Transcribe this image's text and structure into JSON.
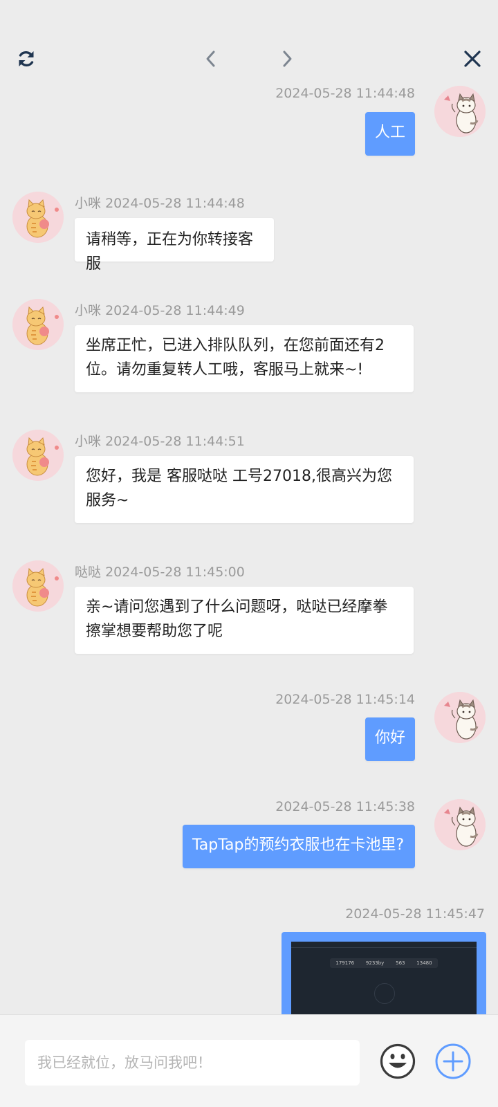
{
  "nav": {
    "refresh_icon": "refresh-icon",
    "prev_icon": "chevron-left-icon",
    "next_icon": "chevron-right-icon",
    "close_icon": "close-icon"
  },
  "messages": [
    {
      "side": "out",
      "time": "2024-05-28 11:44:48",
      "text": "人工"
    },
    {
      "side": "in",
      "sender": "小咪",
      "time": "2024-05-28 11:44:48",
      "text": "请稍等，正在为你转接客服"
    },
    {
      "side": "in",
      "sender": "小咪",
      "time": "2024-05-28 11:44:49",
      "text": "坐席正忙，已进入排队队列，在您前面还有2位。请勿重复转人工哦，客服马上就来~!"
    },
    {
      "side": "in",
      "sender": "小咪",
      "time": "2024-05-28 11:44:51",
      "text": "您好，我是 客服哒哒 工号27018,很高兴为您服务~"
    },
    {
      "side": "in",
      "sender": "哒哒",
      "time": "2024-05-28 11:45:00",
      "text": "亲~请问您遇到了什么问题呀，哒哒已经摩拳擦掌想要帮助您了呢"
    },
    {
      "side": "out",
      "time": "2024-05-28 11:45:14",
      "text": "你好"
    },
    {
      "side": "out",
      "time": "2024-05-28 11:45:38",
      "text": "TapTap的预约衣服也在卡池里?"
    },
    {
      "side": "out",
      "time": "2024-05-28 11:45:47",
      "image": true,
      "image_stats": [
        "179176",
        "9233by",
        "563",
        "13480"
      ]
    }
  ],
  "composer": {
    "placeholder": "我已经就位，放马问我吧！",
    "emoji_icon": "emoji-icon",
    "plus_icon": "plus-icon"
  },
  "colors": {
    "background": "#ececec",
    "user_bubble": "#5f9cff",
    "agent_bubble": "#ffffff",
    "accent": "#5f9cff"
  }
}
